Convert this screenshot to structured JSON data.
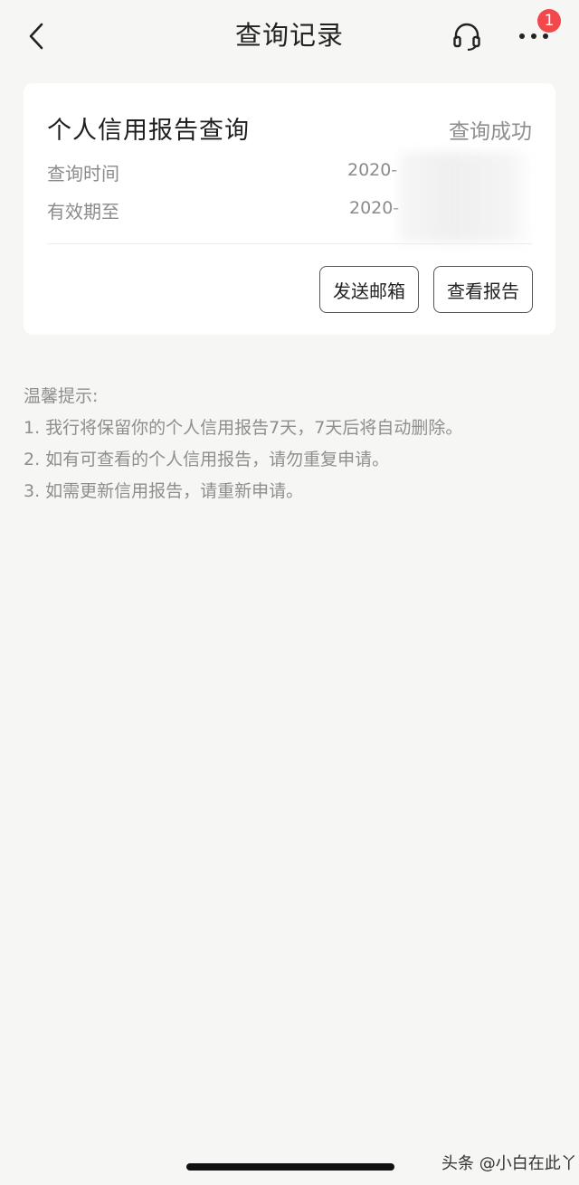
{
  "header": {
    "title": "查询记录",
    "badge_count": "1",
    "icons": [
      "back-chevron-icon",
      "headset-icon",
      "more-dots-icon"
    ]
  },
  "record": {
    "title": "个人信用报告查询",
    "status": "查询成功",
    "query_time_label": "查询时间",
    "query_time_value": "2020-",
    "valid_until_label": "有效期至",
    "valid_until_value": "2020-",
    "send_email_button": "发送邮箱",
    "view_report_button": "查看报告"
  },
  "tips": {
    "heading": "温馨提示:",
    "items": [
      "1. 我行将保留你的个人信用报告7天，7天后将自动删除。",
      "2. 如有可查看的个人信用报告，请勿重复申请。",
      "3. 如需更新信用报告，请重新申请。"
    ]
  },
  "watermark": "头条 @小白在此丫",
  "colors": {
    "background": "#f6f6f4",
    "card": "#ffffff",
    "badge": "#f2484b",
    "muted_text": "#8b8b8b"
  }
}
